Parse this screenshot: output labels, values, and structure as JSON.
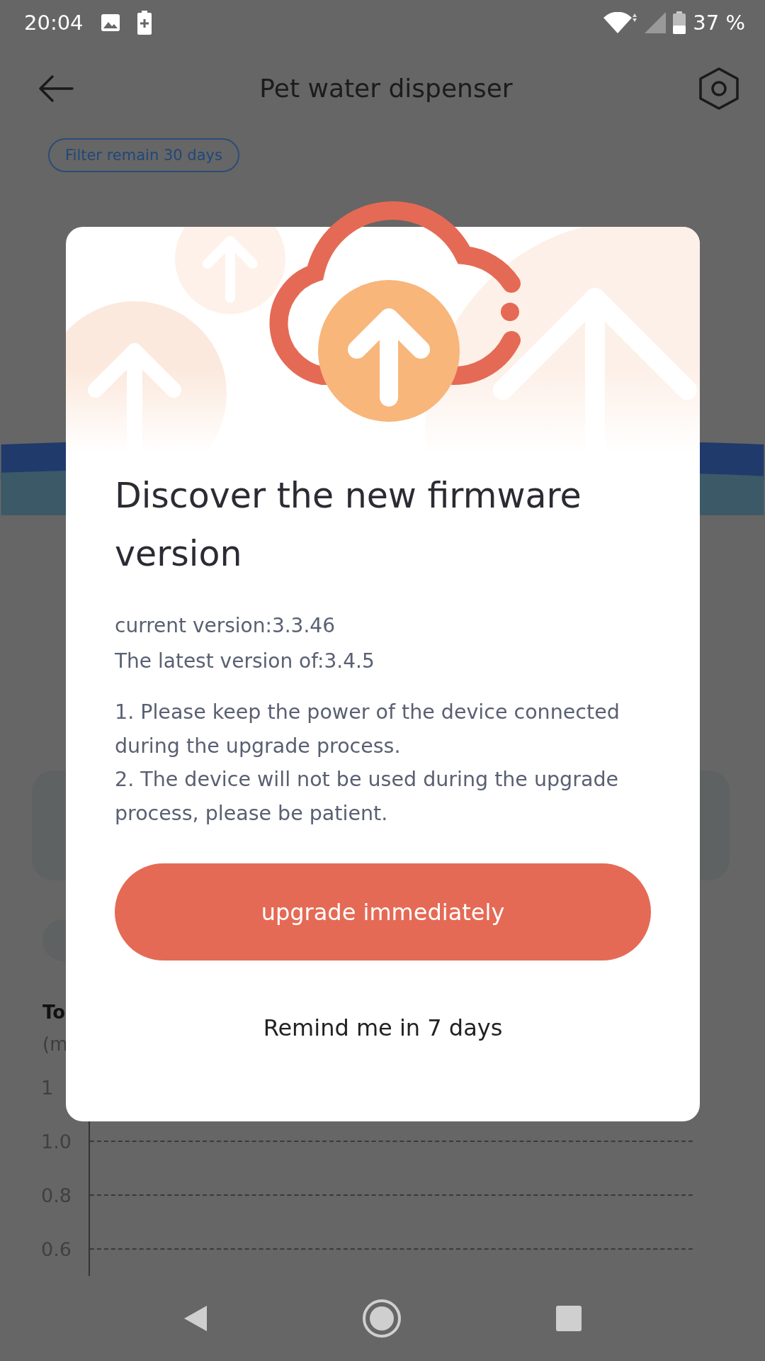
{
  "status_bar": {
    "time": "20:04",
    "battery": "37 %"
  },
  "header": {
    "title": "Pet water dispenser"
  },
  "filter_badge": "Filter remain 30 days",
  "chart": {
    "title": "To",
    "unit": "(m",
    "y_labels": [
      "1",
      "1.0",
      "0.8",
      "0.6"
    ]
  },
  "dialog": {
    "title": "Discover the new firmware version",
    "current_version": "current version:3.3.46",
    "latest_version": "The latest version of:3.4.5",
    "notes": [
      "1. Please keep the power of the device connected during the upgrade process.",
      "2. The device will not be used during the upgrade process, please be patient."
    ],
    "primary_button": "upgrade immediately",
    "secondary_button": "Remind me in 7 days"
  }
}
